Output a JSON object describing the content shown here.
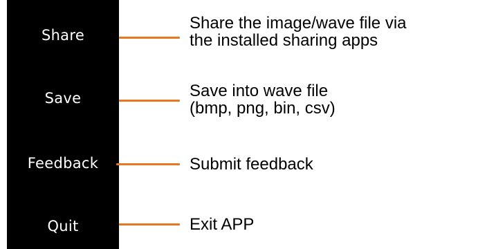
{
  "menu": {
    "items": [
      {
        "label": "Share"
      },
      {
        "label": "Save"
      },
      {
        "label": "Feedback"
      },
      {
        "label": "Quit"
      }
    ]
  },
  "callouts": [
    {
      "lines": [
        "Share the image/wave file via",
        "the installed sharing apps"
      ]
    },
    {
      "lines": [
        "Save into wave file",
        "(bmp, png, bin, csv)"
      ]
    },
    {
      "lines": [
        "Submit feedback"
      ]
    },
    {
      "lines": [
        "Exit APP"
      ]
    }
  ],
  "colors": {
    "panel_background": "#000000",
    "menu_text": "#ffffff",
    "leader_line": "#E87722",
    "callout_text": "#000000"
  }
}
